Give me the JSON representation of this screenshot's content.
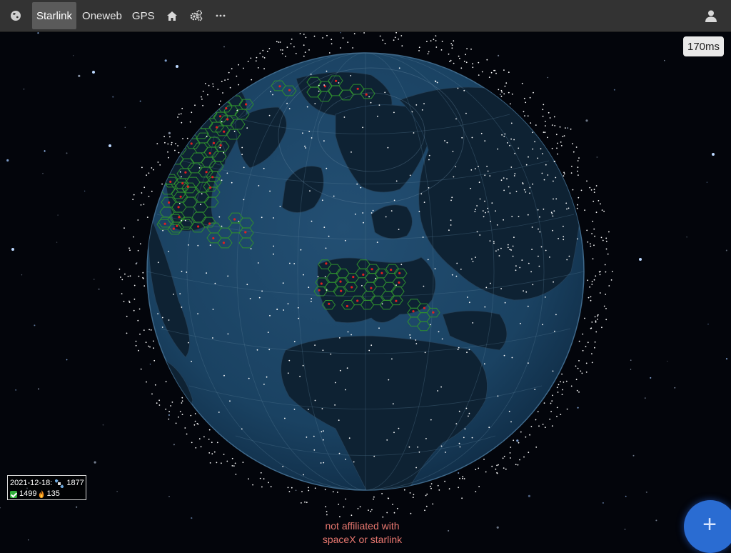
{
  "nav": {
    "items": [
      {
        "label": "Starlink",
        "active": true
      },
      {
        "label": "Oneweb",
        "active": false
      },
      {
        "label": "GPS",
        "active": false
      }
    ],
    "icons": [
      "globe-icon",
      "home-icon",
      "settings-icon",
      "more-icon",
      "user-icon"
    ]
  },
  "ping": "170ms",
  "stats": {
    "date": "2021-12-18:",
    "total": "1877",
    "active": "1499",
    "decayed": "135"
  },
  "disclaimer": {
    "line1": "not affiliated with",
    "line2": "spaceX or starlink"
  },
  "fab": {
    "label": "+"
  },
  "colors": {
    "topbar": "#333333",
    "ocean": "#1b4567",
    "land": "#0e2233",
    "cell": "#2f8f2f",
    "fab": "#2a6cd2",
    "disclaimer": "#e8776f"
  }
}
